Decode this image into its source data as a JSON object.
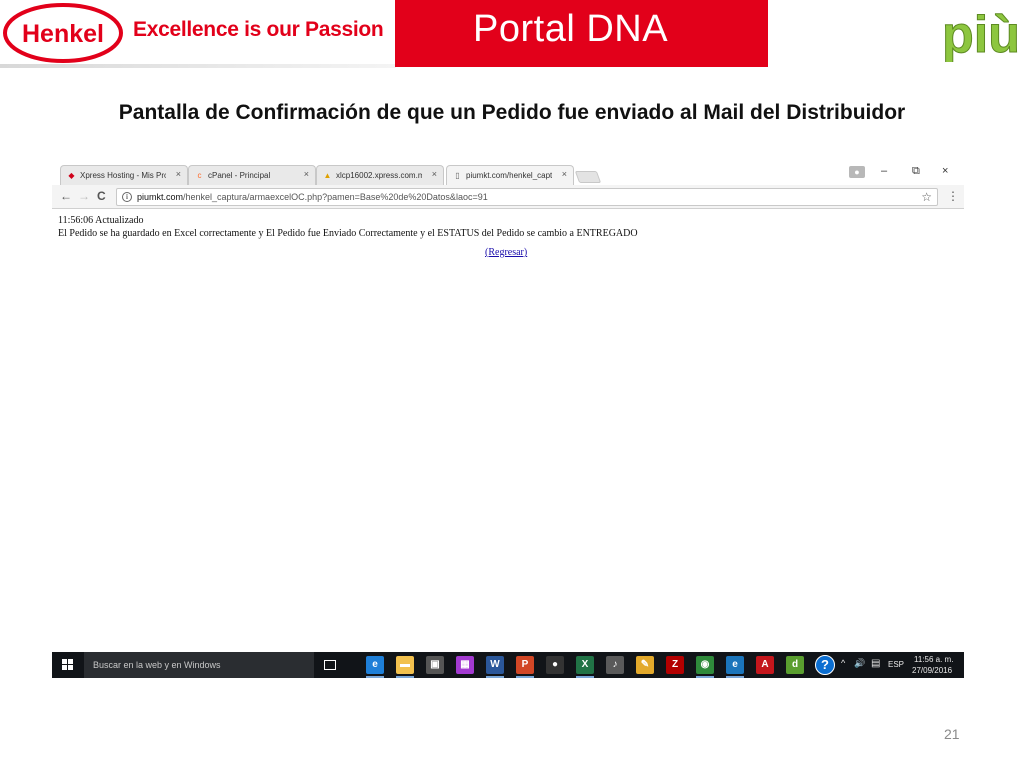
{
  "slide": {
    "henkel_logo_text": "Henkel",
    "tagline": "Excellence is our Passion",
    "portal_title": "Portal  DNA",
    "piu_logo_text": "più",
    "title": "Pantalla de Confirmación  de que un Pedido fue enviado al Mail del Distribuidor",
    "page_number": "21",
    "colors": {
      "henkel_red": "#e2001a",
      "piu_green": "#8dc63f"
    }
  },
  "browser": {
    "tabs": [
      {
        "label": "Xpress Hosting - Mis Pro",
        "icon": "xpress-hosting-favicon",
        "close": "×",
        "active": false
      },
      {
        "label": "cPanel - Principal",
        "icon": "cpanel-favicon",
        "close": "×",
        "active": false
      },
      {
        "label": "xlcp16002.xpress.com.m",
        "icon": "server-favicon",
        "close": "×",
        "active": false
      },
      {
        "label": "piumkt.com/henkel_capt",
        "icon": "page-favicon",
        "close": "×",
        "active": true
      }
    ],
    "window_controls": {
      "minimize": "–",
      "restore": "⧉",
      "close": "×"
    },
    "nav": {
      "back": "←",
      "forward": "→",
      "reload": "C"
    },
    "address": {
      "domain": "piumkt.com",
      "path": "/henkel_captura/armaexcelOC.php?pamen=Base%20de%20Datos&laoc=91"
    },
    "star": "☆",
    "menu": "⋮",
    "page": {
      "time_status": "11:56:06 Actualizado",
      "message": "El Pedido se ha guardado en Excel correctamente y El Pedido fue Enviado Correctamente y el ESTATUS del Pedido se cambio a ENTREGADO",
      "return_link": "(Regresar)"
    }
  },
  "taskbar": {
    "search_placeholder": "Buscar en la web y en Windows",
    "pinned_apps": [
      {
        "name": "edge-icon",
        "glyph": "e",
        "color": "#1e7fd8",
        "running": true
      },
      {
        "name": "file-explorer-icon",
        "glyph": "▬",
        "color": "#f2c14e",
        "running": true
      },
      {
        "name": "store-icon",
        "glyph": "▣",
        "color": "#555555",
        "running": false
      },
      {
        "name": "paint-icon",
        "glyph": "▦",
        "color": "#a33ad1",
        "running": false
      },
      {
        "name": "word-icon",
        "glyph": "W",
        "color": "#2b579a",
        "running": true
      },
      {
        "name": "powerpoint-icon",
        "glyph": "P",
        "color": "#d24726",
        "running": true
      },
      {
        "name": "media-icon",
        "glyph": "●",
        "color": "#333333",
        "running": false
      },
      {
        "name": "excel-icon",
        "glyph": "X",
        "color": "#217346",
        "running": true
      },
      {
        "name": "recorder-icon",
        "glyph": "♪",
        "color": "#5a5a5a",
        "running": false
      },
      {
        "name": "notes-icon",
        "glyph": "✎",
        "color": "#e3a92b",
        "running": false
      },
      {
        "name": "filezilla-icon",
        "glyph": "Z",
        "color": "#b30000",
        "running": false
      },
      {
        "name": "chrome-icon",
        "glyph": "◉",
        "color": "#2f8a3b",
        "running": true
      },
      {
        "name": "internet-explorer-icon",
        "glyph": "e",
        "color": "#1b75bb",
        "running": true
      },
      {
        "name": "acrobat-icon",
        "glyph": "A",
        "color": "#c4161c",
        "running": false
      },
      {
        "name": "dreamweaver-icon",
        "glyph": "d",
        "color": "#5a9e2f",
        "running": false
      }
    ],
    "help": "?",
    "tray": {
      "up": "^",
      "volume": "🔊",
      "message": "▤",
      "lang": "ESP"
    },
    "clock": {
      "time": "11:56 a. m.",
      "date": "27/09/2016"
    }
  }
}
